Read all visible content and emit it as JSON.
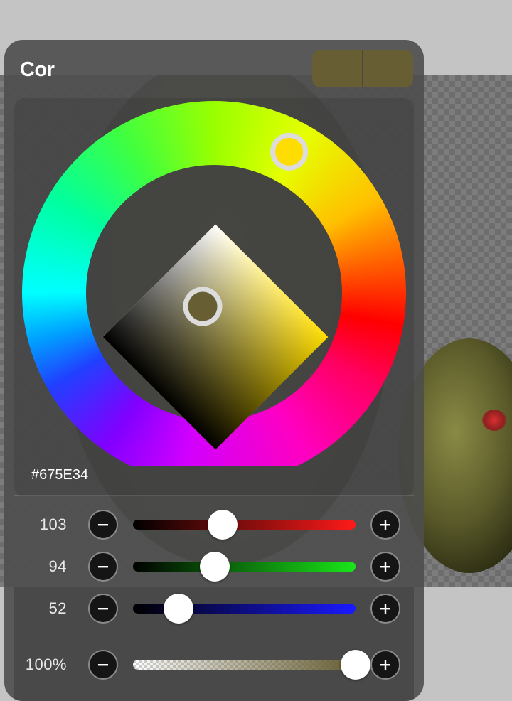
{
  "panel": {
    "title": "Cor",
    "swatches": {
      "previous": "#675E34",
      "current": "#675E34"
    },
    "hex_value": "#675E34",
    "wheel": {
      "hue_degrees": 52,
      "selected_color": "#675E34"
    },
    "sliders": [
      {
        "key": "red",
        "label": "103",
        "value": 103,
        "max": 255,
        "track_end": "#ff1a1a"
      },
      {
        "key": "green",
        "label": "94",
        "value": 94,
        "max": 255,
        "track_end": "#19e619"
      },
      {
        "key": "blue",
        "label": "52",
        "value": 52,
        "max": 255,
        "track_end": "#1a1aff"
      },
      {
        "key": "alpha",
        "label": "100%",
        "value": 100,
        "max": 100,
        "track_end": "#675E34"
      }
    ],
    "icons": {
      "decrease": "minus-icon",
      "increase": "plus-icon"
    }
  }
}
